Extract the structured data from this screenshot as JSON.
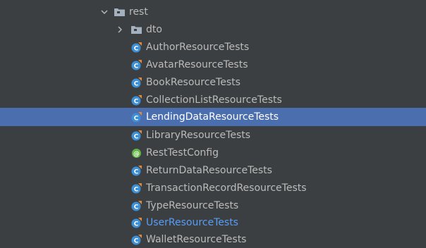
{
  "project_tree": {
    "folders": [
      {
        "label": "rest",
        "expanded": true,
        "arrow": "chevron-down-icon"
      },
      {
        "label": "dto",
        "expanded": false,
        "arrow": "chevron-right-icon"
      }
    ],
    "files": [
      {
        "label": "AuthorResourceTests",
        "icon": "junit-test-class-icon",
        "selected": false
      },
      {
        "label": "AvatarResourceTests",
        "icon": "junit-test-class-icon",
        "selected": false
      },
      {
        "label": "BookResourceTests",
        "icon": "junit-test-class-icon",
        "selected": false
      },
      {
        "label": "CollectionListResourceTests",
        "icon": "junit-test-class-icon",
        "selected": false
      },
      {
        "label": "LendingDataResourceTests",
        "icon": "junit-test-class-icon",
        "selected": true
      },
      {
        "label": "LibraryResourceTests",
        "icon": "junit-test-class-icon",
        "selected": false
      },
      {
        "label": "RestTestConfig",
        "icon": "config-annotation-icon",
        "selected": false
      },
      {
        "label": "ReturnDataResourceTests",
        "icon": "junit-test-class-icon",
        "selected": false
      },
      {
        "label": "TransactionRecordResourceTests",
        "icon": "junit-test-class-icon",
        "selected": false
      },
      {
        "label": "TypeResourceTests",
        "icon": "junit-test-class-icon",
        "selected": false
      },
      {
        "label": "UserResourceTests",
        "icon": "junit-test-class-icon",
        "selected": false,
        "modified": true
      },
      {
        "label": "WalletResourceTests",
        "icon": "junit-test-class-icon",
        "selected": false
      }
    ]
  },
  "colors": {
    "background": "#3c3f41",
    "text": "#bbbbbb",
    "selection": "#4b6eaf",
    "modified_text": "#589df6",
    "class_icon": "#3d8fd6",
    "test_badge": "#e38a3a",
    "config_icon": "#62b543",
    "folder": "#a4b0bd"
  }
}
